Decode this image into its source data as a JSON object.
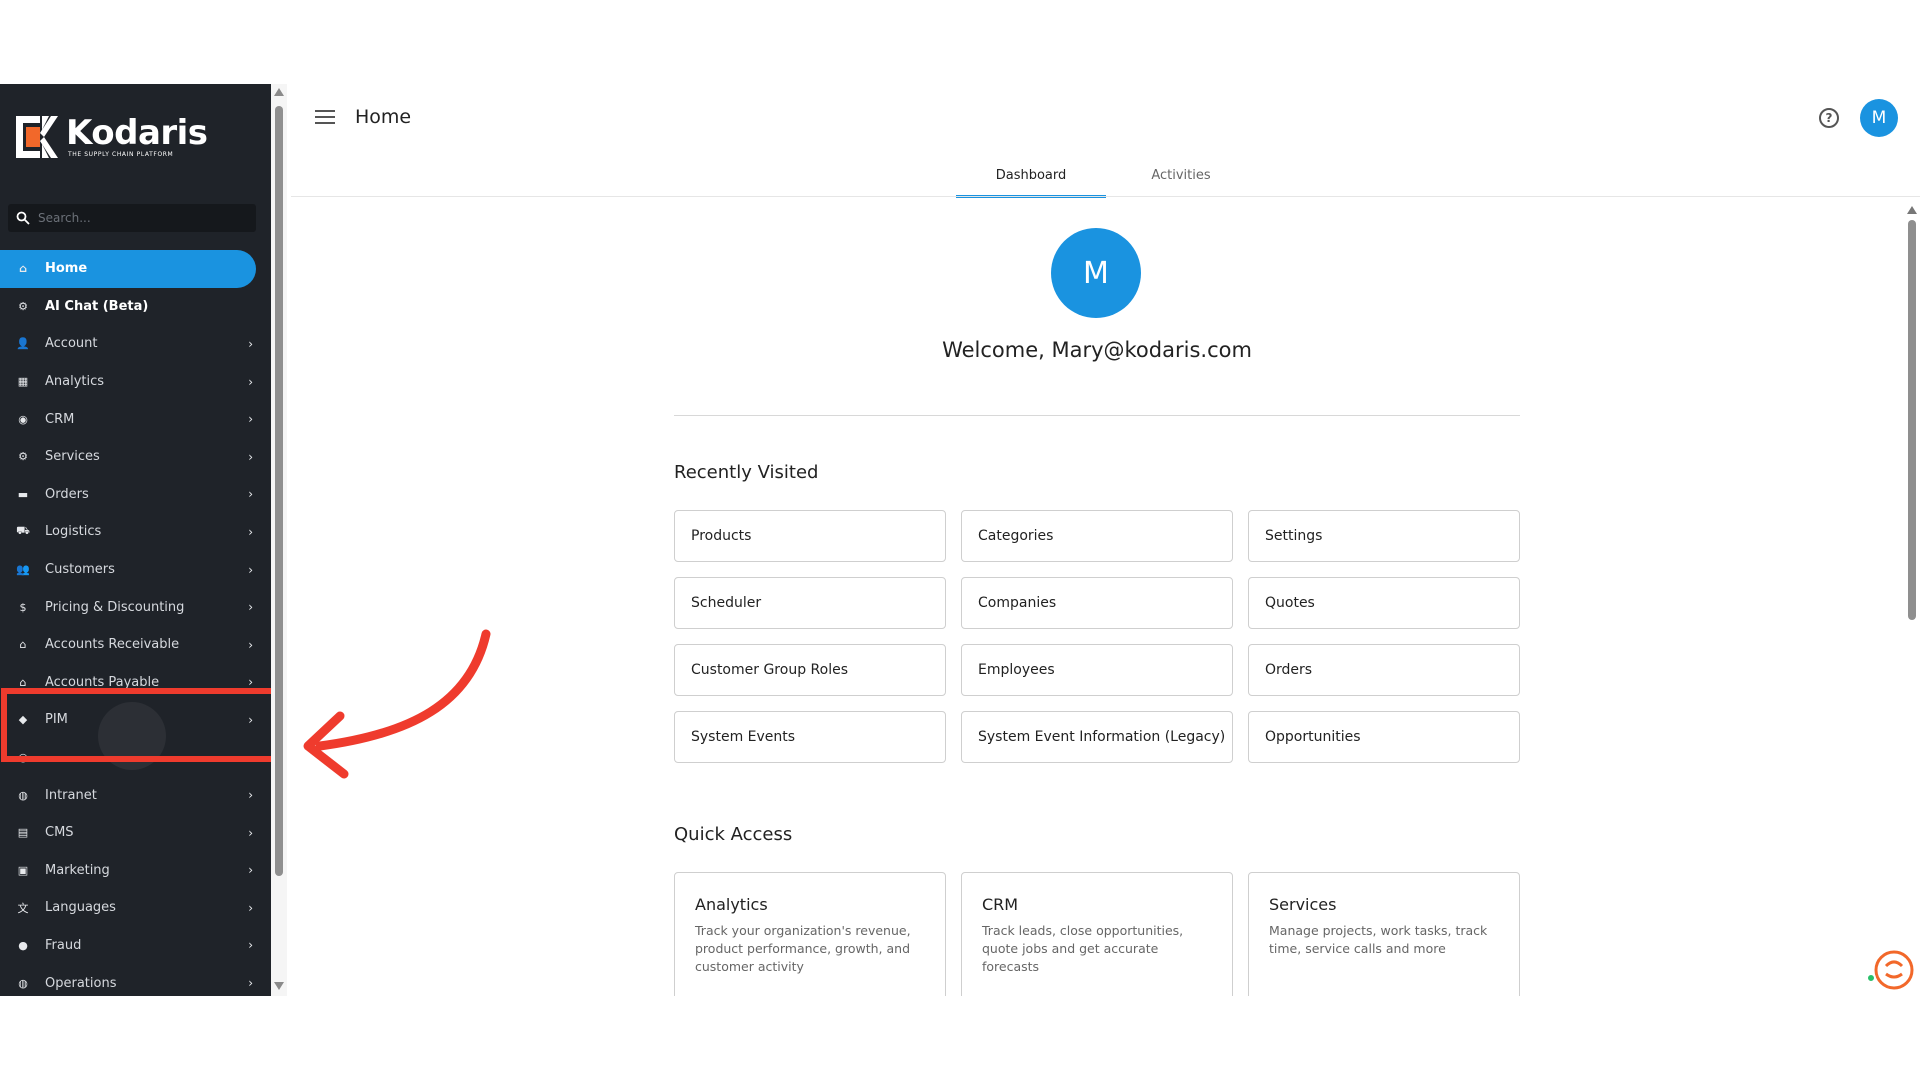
{
  "app": {
    "brand": "Kodaris",
    "tagline": "THE SUPPLY CHAIN PLATFORM",
    "accent_color": "#1a93e0",
    "sidebar_bg": "#1f2329"
  },
  "sidebar": {
    "search_placeholder": "Search...",
    "items": [
      {
        "label": "Home",
        "icon": "home-icon",
        "active": true,
        "has_chevron": false
      },
      {
        "label": "AI Chat (Beta)",
        "icon": "robot-icon",
        "active": false,
        "has_chevron": false
      },
      {
        "label": "Account",
        "icon": "user-icon",
        "active": false,
        "has_chevron": true
      },
      {
        "label": "Analytics",
        "icon": "chart-icon",
        "active": false,
        "has_chevron": true
      },
      {
        "label": "CRM",
        "icon": "contact-icon",
        "active": false,
        "has_chevron": true
      },
      {
        "label": "Services",
        "icon": "gears-icon",
        "active": false,
        "has_chevron": true
      },
      {
        "label": "Orders",
        "icon": "truck-icon",
        "active": false,
        "has_chevron": true
      },
      {
        "label": "Logistics",
        "icon": "shipping-icon",
        "active": false,
        "has_chevron": true
      },
      {
        "label": "Customers",
        "icon": "people-icon",
        "active": false,
        "has_chevron": true
      },
      {
        "label": "Pricing & Discounting",
        "icon": "dollar-icon",
        "active": false,
        "has_chevron": true
      },
      {
        "label": "Accounts Receivable",
        "icon": "bank-icon",
        "active": false,
        "has_chevron": true
      },
      {
        "label": "Accounts Payable",
        "icon": "bank-icon",
        "active": false,
        "has_chevron": true
      },
      {
        "label": "PIM",
        "icon": "tag-icon",
        "active": false,
        "has_chevron": true
      },
      {
        "label": "",
        "icon": "search-icon",
        "active": false,
        "has_chevron": false
      },
      {
        "label": "Intranet",
        "icon": "globe-icon",
        "active": false,
        "has_chevron": true
      },
      {
        "label": "CMS",
        "icon": "cms-icon",
        "active": false,
        "has_chevron": true
      },
      {
        "label": "Marketing",
        "icon": "megaphone-icon",
        "active": false,
        "has_chevron": true
      },
      {
        "label": "Languages",
        "icon": "translate-icon",
        "active": false,
        "has_chevron": true
      },
      {
        "label": "Fraud",
        "icon": "alert-icon",
        "active": false,
        "has_chevron": true
      },
      {
        "label": "Operations",
        "icon": "operations-icon",
        "active": false,
        "has_chevron": true
      }
    ]
  },
  "topbar": {
    "title": "Home",
    "help_icon": "help-icon",
    "avatar_initial": "M"
  },
  "tabs": [
    {
      "label": "Dashboard",
      "active": true
    },
    {
      "label": "Activities",
      "active": false
    }
  ],
  "welcome": {
    "avatar_initial": "M",
    "text": "Welcome, Mary@kodaris.com"
  },
  "recently_visited": {
    "title": "Recently Visited",
    "items": [
      "Products",
      "Categories",
      "Settings",
      "Scheduler",
      "Companies",
      "Quotes",
      "Customer Group Roles",
      "Employees",
      "Orders",
      "System Events",
      "System Event Information (Legacy)",
      "Opportunities"
    ]
  },
  "quick_access": {
    "title": "Quick Access",
    "items": [
      {
        "title": "Analytics",
        "desc": "Track your organization's revenue, product performance, growth, and customer activity"
      },
      {
        "title": "CRM",
        "desc": "Track leads, close opportunities, quote jobs and get accurate forecasts"
      },
      {
        "title": "Services",
        "desc": "Manage projects, work tasks, track time, service calls and more"
      }
    ]
  },
  "annotation": {
    "highlight_color": "#ef3b2d",
    "highlighted_item": "PIM"
  }
}
